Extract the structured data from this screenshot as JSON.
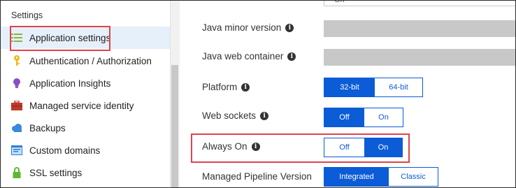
{
  "sidebar": {
    "title": "Settings",
    "items": [
      {
        "label": "Application settings",
        "icon": "list-settings-icon"
      },
      {
        "label": "Authentication / Authorization",
        "icon": "key-icon"
      },
      {
        "label": "Application Insights",
        "icon": "lightbulb-icon"
      },
      {
        "label": "Managed service identity",
        "icon": "toolbox-icon"
      },
      {
        "label": "Backups",
        "icon": "cloud-icon"
      },
      {
        "label": "Custom domains",
        "icon": "web-domain-icon"
      },
      {
        "label": "SSL settings",
        "icon": "lock-icon"
      }
    ]
  },
  "main": {
    "top_partial": {
      "value": "On"
    },
    "java_minor_version": {
      "label": "Java minor version"
    },
    "java_web_container": {
      "label": "Java web container"
    },
    "platform": {
      "label": "Platform",
      "options": [
        "32-bit",
        "64-bit"
      ],
      "selected": "32-bit"
    },
    "web_sockets": {
      "label": "Web sockets",
      "options": [
        "Off",
        "On"
      ],
      "selected": "Off"
    },
    "always_on": {
      "label": "Always On",
      "options": [
        "Off",
        "On"
      ],
      "selected": "On"
    },
    "managed_pipeline": {
      "label": "Managed Pipeline Version",
      "options": [
        "Integrated",
        "Classic"
      ],
      "selected": "Integrated"
    }
  },
  "colors": {
    "accent": "#0b5cd6",
    "highlight": "#e0434a",
    "selected_bg": "#e6f0fb"
  }
}
